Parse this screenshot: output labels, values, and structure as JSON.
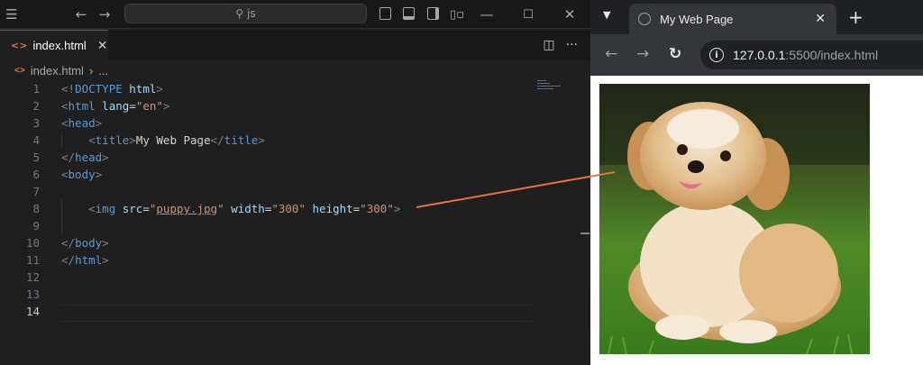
{
  "vscode": {
    "search_text": "js",
    "tab_label": "index.html",
    "breadcrumb": [
      "index.html",
      "..."
    ],
    "code_lines": [
      {
        "n": "1",
        "tokens": [
          [
            "br",
            "<!"
          ],
          [
            "tag",
            "DOCTYPE"
          ],
          [
            "txt",
            " "
          ],
          [
            "attr",
            "html"
          ],
          [
            "br",
            ">"
          ]
        ]
      },
      {
        "n": "2",
        "tokens": [
          [
            "br",
            "<"
          ],
          [
            "tag",
            "html"
          ],
          [
            "txt",
            " "
          ],
          [
            "attr",
            "lang"
          ],
          [
            "txt",
            "="
          ],
          [
            "str",
            "\"en\""
          ],
          [
            "br",
            ">"
          ]
        ]
      },
      {
        "n": "3",
        "tokens": [
          [
            "br",
            "<"
          ],
          [
            "tag",
            "head"
          ],
          [
            "br",
            ">"
          ]
        ]
      },
      {
        "n": "4",
        "tokens": [
          [
            "txt",
            "    "
          ],
          [
            "br",
            "<"
          ],
          [
            "tag",
            "title"
          ],
          [
            "br",
            ">"
          ],
          [
            "txt",
            "My Web Page"
          ],
          [
            "br",
            "</"
          ],
          [
            "tag",
            "title"
          ],
          [
            "br",
            ">"
          ]
        ]
      },
      {
        "n": "5",
        "tokens": [
          [
            "br",
            "</"
          ],
          [
            "tag",
            "head"
          ],
          [
            "br",
            ">"
          ]
        ]
      },
      {
        "n": "6",
        "tokens": [
          [
            "br",
            "<"
          ],
          [
            "tag",
            "body"
          ],
          [
            "br",
            ">"
          ]
        ]
      },
      {
        "n": "7",
        "tokens": []
      },
      {
        "n": "8",
        "tokens": [
          [
            "txt",
            "    "
          ],
          [
            "br",
            "<"
          ],
          [
            "tag",
            "img"
          ],
          [
            "txt",
            " "
          ],
          [
            "attr",
            "src"
          ],
          [
            "txt",
            "="
          ],
          [
            "str",
            "\""
          ],
          [
            "strU",
            "puppy.jpg"
          ],
          [
            "str",
            "\""
          ],
          [
            "txt",
            " "
          ],
          [
            "attr",
            "width"
          ],
          [
            "txt",
            "="
          ],
          [
            "str",
            "\"300\""
          ],
          [
            "txt",
            " "
          ],
          [
            "attr",
            "height"
          ],
          [
            "txt",
            "="
          ],
          [
            "str",
            "\"300\""
          ],
          [
            "br",
            ">"
          ]
        ]
      },
      {
        "n": "9",
        "tokens": []
      },
      {
        "n": "10",
        "tokens": [
          [
            "br",
            "</"
          ],
          [
            "tag",
            "body"
          ],
          [
            "br",
            ">"
          ]
        ]
      },
      {
        "n": "11",
        "tokens": [
          [
            "br",
            "</"
          ],
          [
            "tag",
            "html"
          ],
          [
            "br",
            ">"
          ]
        ]
      },
      {
        "n": "12",
        "tokens": []
      },
      {
        "n": "13",
        "tokens": []
      },
      {
        "n": "14",
        "tokens": []
      }
    ],
    "active_line": "14"
  },
  "browser": {
    "tab_title": "My Web Page",
    "url_host": "127.0.0.1",
    "url_path": ":5500/index.html"
  },
  "colors": {
    "accent": "#0078d4",
    "html_icon": "#e8733b",
    "annotation_arrow": "#e8733b"
  }
}
